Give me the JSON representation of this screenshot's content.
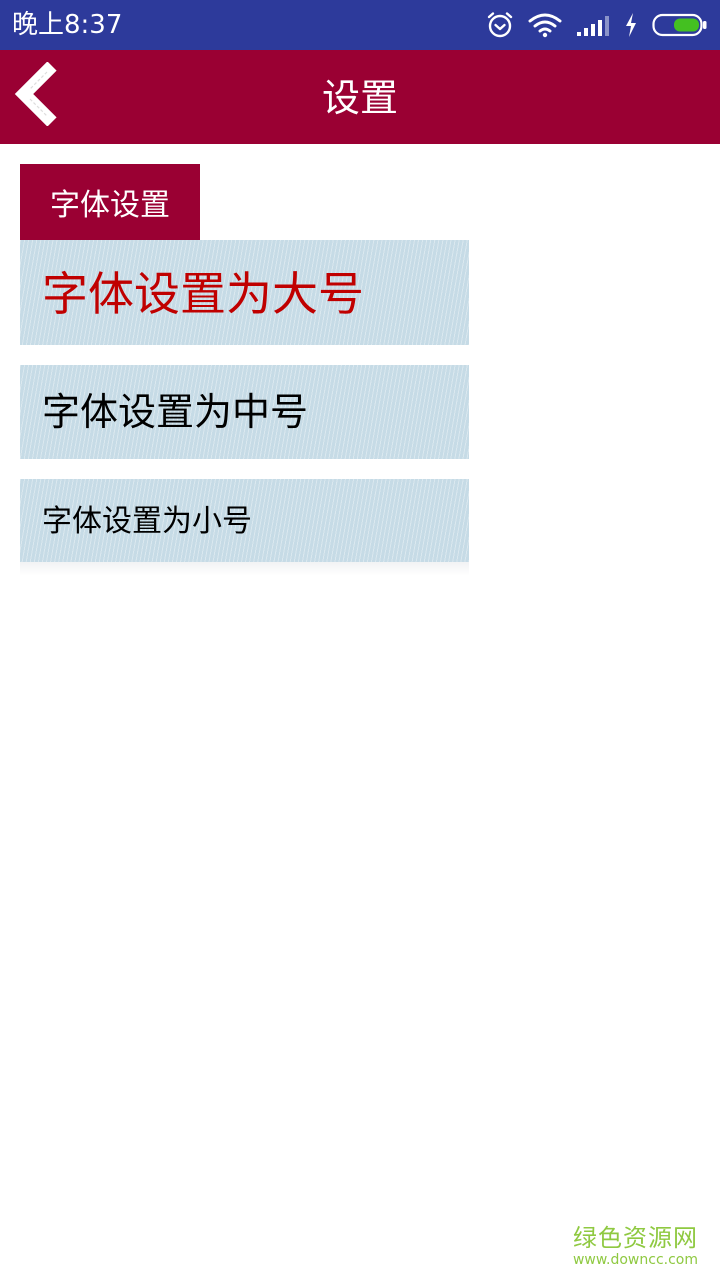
{
  "status_bar": {
    "time": "晚上8:37",
    "icons": [
      "alarm-icon",
      "wifi-icon",
      "signal-icon",
      "charging-icon",
      "battery-icon"
    ],
    "colors": {
      "background": "#2d3a9b",
      "battery_fill": "#44c021"
    }
  },
  "header": {
    "title": "设置",
    "back_icon": "chevron-left-icon",
    "colors": {
      "background": "#9a0033"
    }
  },
  "settings": {
    "section_label": "字体设置",
    "options": [
      {
        "label": "字体设置为大号",
        "selected": true
      },
      {
        "label": "字体设置为中号",
        "selected": false
      },
      {
        "label": "字体设置为小号",
        "selected": false
      }
    ],
    "colors": {
      "selected_text": "#c00000",
      "option_background": "#c6dbe6"
    }
  },
  "watermark": {
    "text": "绿色资源网",
    "url": "www.downcc.com"
  }
}
